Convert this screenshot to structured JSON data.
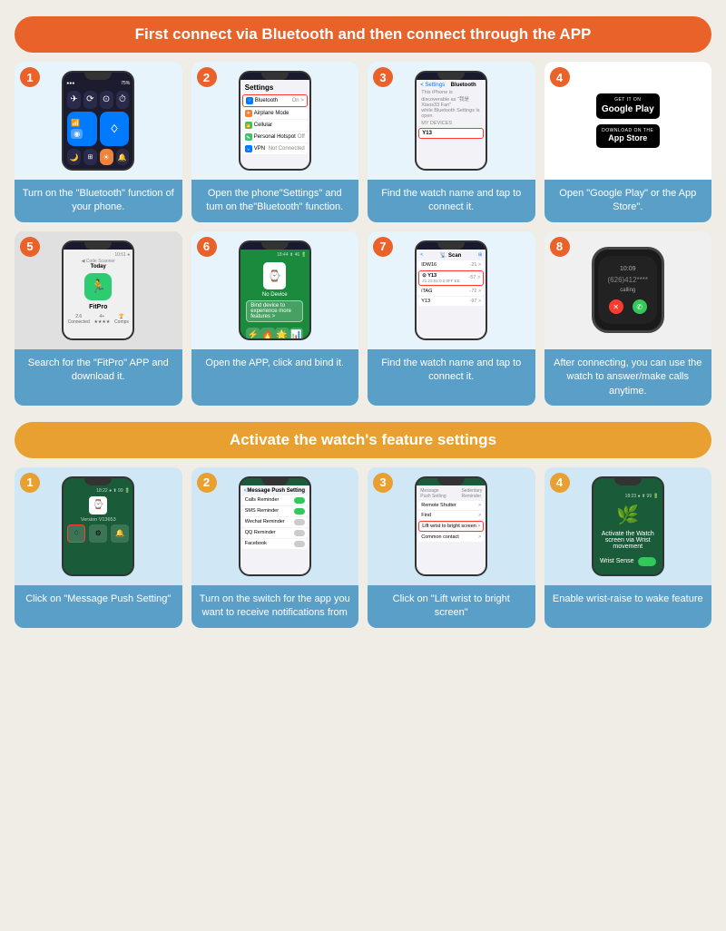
{
  "section1": {
    "header": "First connect via Bluetooth and then connect through the APP",
    "steps": [
      {
        "number": "1",
        "desc": "Turn on the \"Bluetooth\" function of your phone."
      },
      {
        "number": "2",
        "desc": "Open the phone\"Settings\" and tum on the\"Bluetooth\" function."
      },
      {
        "number": "3",
        "desc": "Find the watch name and tap to connect it."
      },
      {
        "number": "4",
        "desc": "Open \"Google Play\" or the App Store\"."
      },
      {
        "number": "5",
        "desc": "Search for the \"FitPro\" APP and download it."
      },
      {
        "number": "6",
        "desc": "Open the APP, click and bind it."
      },
      {
        "number": "7",
        "desc": "Find the watch name and tap to connect it."
      },
      {
        "number": "8",
        "desc": "After connecting, you can use the watch to answer/make calls anytime."
      }
    ],
    "googlePlay": "Google Play",
    "getItOn": "GET IT ON",
    "downloadOn": "Download on the",
    "appStore": "App Store"
  },
  "section2": {
    "header": "Activate the watch's feature settings",
    "steps": [
      {
        "number": "1",
        "desc": "Click on \"Message Push Setting\""
      },
      {
        "number": "2",
        "desc": "Turn on the switch for the app you want to receive notifications from"
      },
      {
        "number": "3",
        "desc": "Click on \"Lift wrist to bright screen\""
      },
      {
        "number": "4",
        "desc": "Enable wrist-raise to wake feature"
      }
    ]
  }
}
